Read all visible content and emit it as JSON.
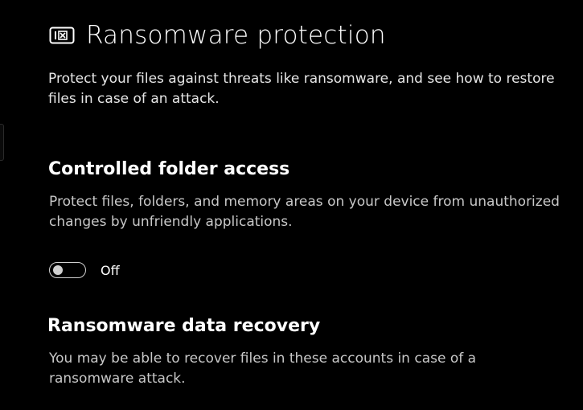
{
  "header": {
    "icon": "ransomware-protection-icon",
    "title": "Ransomware protection",
    "description": "Protect your files against threats like ransomware, and see how to restore files in case of an attack."
  },
  "controlled_folder_access": {
    "title": "Controlled folder access",
    "description": "Protect files, folders, and memory areas on your device from unauthorized changes by unfriendly applications.",
    "toggle": {
      "state": false,
      "label": "Off"
    }
  },
  "ransomware_data_recovery": {
    "title": "Ransomware data recovery",
    "description": "You may be able to recover files in these accounts in case of a ransomware attack."
  },
  "colors": {
    "background": "#000000",
    "text": "#ffffff",
    "secondary_text": "#c8c8c8",
    "toggle_off": "#d0d0d0"
  }
}
